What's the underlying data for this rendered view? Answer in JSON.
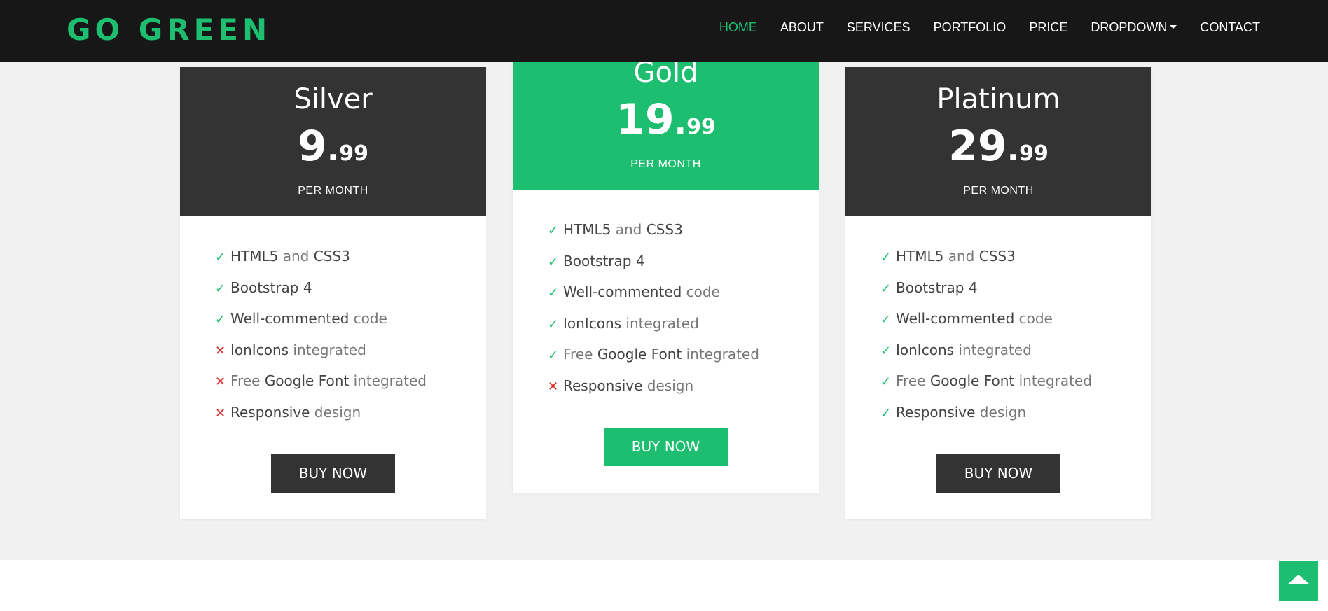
{
  "brand": "GO GREEN",
  "nav": {
    "items": [
      "HOME",
      "ABOUT",
      "SERVICES",
      "PORTFOLIO",
      "PRICE",
      "DROPDOWN",
      "CONTACT"
    ],
    "active": "HOME"
  },
  "colors": {
    "accent": "#1ebe71",
    "dark": "#333333",
    "navbar": "#171717",
    "no": "#e02a2a"
  },
  "plans": [
    {
      "name": "Silver",
      "price_int": "9",
      "price_cents": "99",
      "period": "PER MONTH",
      "cta": "BUY NOW",
      "features": [
        {
          "included": true,
          "parts": [
            [
              "HTML5",
              true
            ],
            [
              " and ",
              false
            ],
            [
              "CSS3",
              true
            ]
          ]
        },
        {
          "included": true,
          "parts": [
            [
              "Bootstrap 4",
              true
            ]
          ]
        },
        {
          "included": true,
          "parts": [
            [
              "Well-commented",
              true
            ],
            [
              " code",
              false
            ]
          ]
        },
        {
          "included": false,
          "parts": [
            [
              "IonIcons",
              true
            ],
            [
              " integrated",
              false
            ]
          ]
        },
        {
          "included": false,
          "parts": [
            [
              "Free ",
              false
            ],
            [
              "Google Font",
              true
            ],
            [
              " integrated",
              false
            ]
          ]
        },
        {
          "included": false,
          "parts": [
            [
              "Responsive",
              true
            ],
            [
              " design",
              false
            ]
          ]
        }
      ]
    },
    {
      "name": "Gold",
      "price_int": "19",
      "price_cents": "99",
      "period": "PER MONTH",
      "cta": "BUY NOW",
      "features": [
        {
          "included": true,
          "parts": [
            [
              "HTML5",
              true
            ],
            [
              " and ",
              false
            ],
            [
              "CSS3",
              true
            ]
          ]
        },
        {
          "included": true,
          "parts": [
            [
              "Bootstrap 4",
              true
            ]
          ]
        },
        {
          "included": true,
          "parts": [
            [
              "Well-commented",
              true
            ],
            [
              " code",
              false
            ]
          ]
        },
        {
          "included": true,
          "parts": [
            [
              "IonIcons",
              true
            ],
            [
              " integrated",
              false
            ]
          ]
        },
        {
          "included": true,
          "parts": [
            [
              "Free ",
              false
            ],
            [
              "Google Font",
              true
            ],
            [
              " integrated",
              false
            ]
          ]
        },
        {
          "included": false,
          "parts": [
            [
              "Responsive",
              true
            ],
            [
              " design",
              false
            ]
          ]
        }
      ]
    },
    {
      "name": "Platinum",
      "price_int": "29",
      "price_cents": "99",
      "period": "PER MONTH",
      "cta": "BUY NOW",
      "features": [
        {
          "included": true,
          "parts": [
            [
              "HTML5",
              true
            ],
            [
              " and ",
              false
            ],
            [
              "CSS3",
              true
            ]
          ]
        },
        {
          "included": true,
          "parts": [
            [
              "Bootstrap 4",
              true
            ]
          ]
        },
        {
          "included": true,
          "parts": [
            [
              "Well-commented",
              true
            ],
            [
              " code",
              false
            ]
          ]
        },
        {
          "included": true,
          "parts": [
            [
              "IonIcons",
              true
            ],
            [
              " integrated",
              false
            ]
          ]
        },
        {
          "included": true,
          "parts": [
            [
              "Free ",
              false
            ],
            [
              "Google Font",
              true
            ],
            [
              " integrated",
              false
            ]
          ]
        },
        {
          "included": true,
          "parts": [
            [
              "Responsive",
              true
            ],
            [
              " design",
              false
            ]
          ]
        }
      ]
    }
  ],
  "icons": {
    "check": "checkmark-icon",
    "cross": "close-icon",
    "back_to_top": "arrow-up-icon"
  }
}
